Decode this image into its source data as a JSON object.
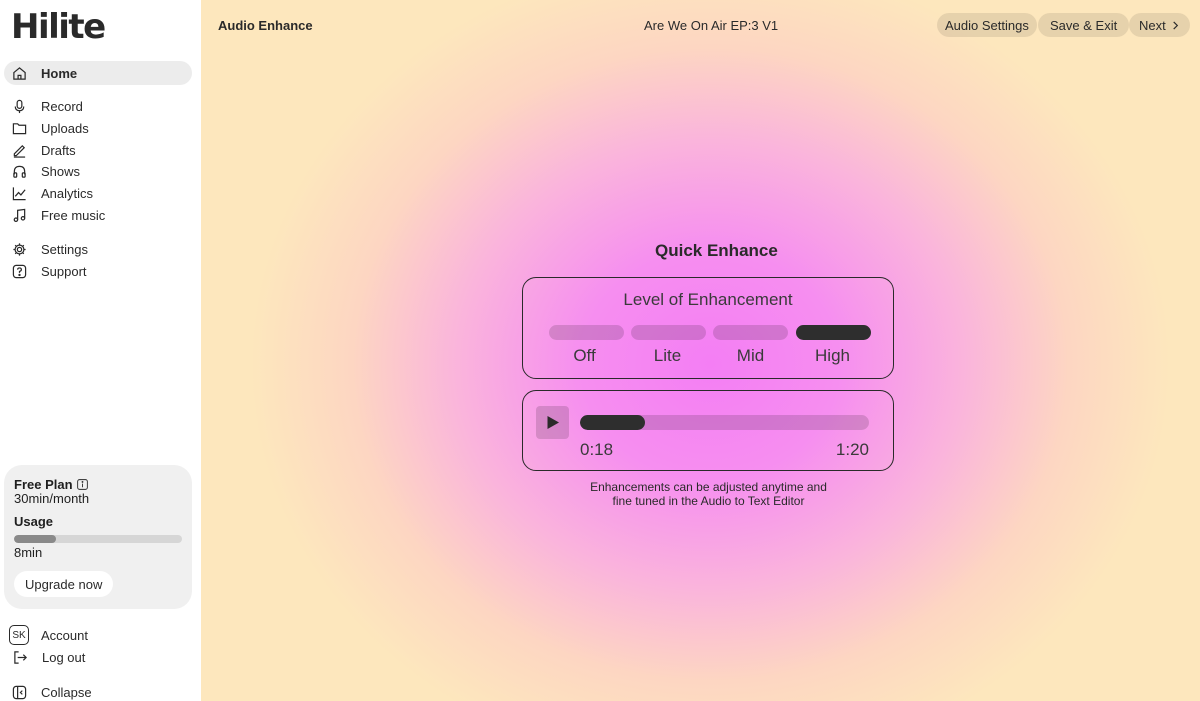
{
  "app": {
    "logo": "Hilite"
  },
  "sidebar": {
    "items": [
      {
        "label": "Home",
        "icon": "home-icon",
        "active": true
      },
      {
        "label": "Record",
        "icon": "mic-icon"
      },
      {
        "label": "Uploads",
        "icon": "folder-icon"
      },
      {
        "label": "Drafts",
        "icon": "pencil-icon"
      },
      {
        "label": "Shows",
        "icon": "headphones-icon"
      },
      {
        "label": "Analytics",
        "icon": "chart-icon"
      },
      {
        "label": "Free music",
        "icon": "music-icon"
      },
      {
        "label": "Settings",
        "icon": "gear-icon"
      },
      {
        "label": "Support",
        "icon": "help-icon"
      }
    ],
    "plan": {
      "title": "Free Plan",
      "allowance": "30min/month",
      "usage_label": "Usage",
      "usage_value": "8min",
      "usage_fraction": 0.25,
      "upgrade_label": "Upgrade now"
    },
    "account": {
      "avatar_initials": "SK",
      "label": "Account"
    },
    "logout_label": "Log out",
    "collapse_label": "Collapse"
  },
  "topbar": {
    "section": "Audio Enhance",
    "episode": "Are We On Air EP:3 V1",
    "audio_settings": "Audio Settings",
    "save_exit": "Save & Exit",
    "next": "Next"
  },
  "enhance": {
    "title": "Quick Enhance",
    "level_heading": "Level of Enhancement",
    "levels": [
      "Off",
      "Lite",
      "Mid",
      "High"
    ],
    "selected_level": "High",
    "player": {
      "current": "0:18",
      "total": "1:20",
      "progress_fraction": 0.225
    },
    "note": "Enhancements can be adjusted anytime and fine tuned in the Audio to Text Editor"
  },
  "colors": {
    "accent": "#2e2e2e",
    "gradient_center": "#f47ef4",
    "gradient_edge": "#fde7bd"
  }
}
